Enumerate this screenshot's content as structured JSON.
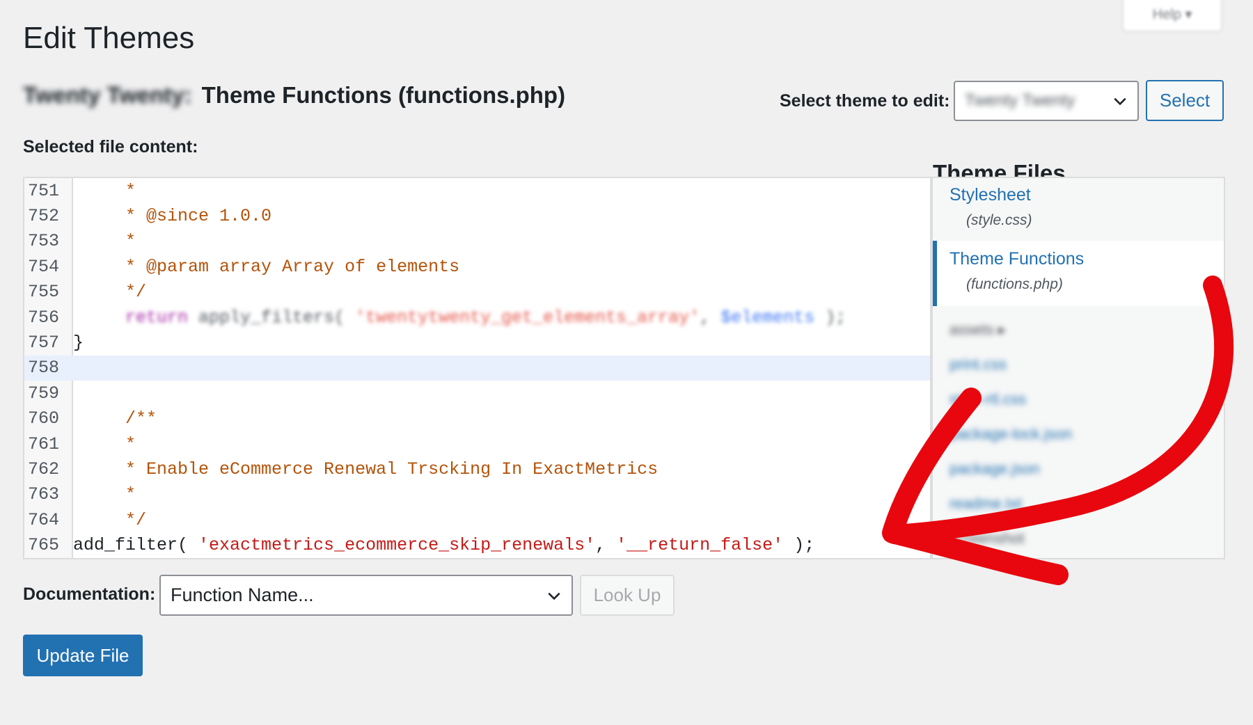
{
  "help_tab": {
    "label": "Help ▾"
  },
  "page": {
    "title": "Edit Themes"
  },
  "file_heading": {
    "theme_name": "Twenty Twenty:",
    "file_label": "Theme Functions (functions.php)"
  },
  "theme_selector": {
    "label": "Select theme to edit:",
    "selected": "Twenty Twenty",
    "button": "Select"
  },
  "editor": {
    "label": "Selected file content:",
    "active_line": "758",
    "lines": [
      {
        "n": "751",
        "text": "     *"
      },
      {
        "n": "752",
        "text": "     * @since 1.0.0"
      },
      {
        "n": "753",
        "text": "     *"
      },
      {
        "n": "754",
        "text": "     * @param array Array of elements"
      },
      {
        "n": "755",
        "text": "     */"
      },
      {
        "n": "756",
        "parts": [
          "return",
          "apply_filters(",
          "'twentytwenty_get_elements_array'",
          ",",
          "$elements",
          ");"
        ]
      },
      {
        "n": "757",
        "text": "}"
      },
      {
        "n": "758",
        "text": ""
      },
      {
        "n": "759",
        "text": ""
      },
      {
        "n": "760",
        "text": "     /**"
      },
      {
        "n": "761",
        "text": "     *"
      },
      {
        "n": "762",
        "text": "     * Enable eCommerce Renewal Trscking In ExactMetrics"
      },
      {
        "n": "763",
        "text": "     *"
      },
      {
        "n": "764",
        "text": "     */"
      },
      {
        "n": "765",
        "parts": [
          "add_filter( ",
          "'exactmetrics_ecommerce_skip_renewals'",
          ", ",
          "'__return_false'",
          " );"
        ]
      }
    ]
  },
  "theme_files": {
    "title": "Theme Files",
    "items": [
      {
        "name": "Stylesheet",
        "file": "(style.css)"
      },
      {
        "name": "Theme Functions",
        "file": "(functions.php)"
      }
    ],
    "blurred_items": [
      "assets ▸",
      "print.css",
      "style-rtl.css",
      "package-lock.json",
      "package.json",
      "readme.txt",
      "screenshot"
    ]
  },
  "documentation": {
    "label": "Documentation:",
    "placeholder": "Function Name...",
    "button": "Look Up"
  },
  "update_button": {
    "label": "Update File"
  },
  "colors": {
    "accent": "#2271b1",
    "arrow": "#e8070e",
    "comment": "#b45309",
    "string": "#c41a16"
  }
}
